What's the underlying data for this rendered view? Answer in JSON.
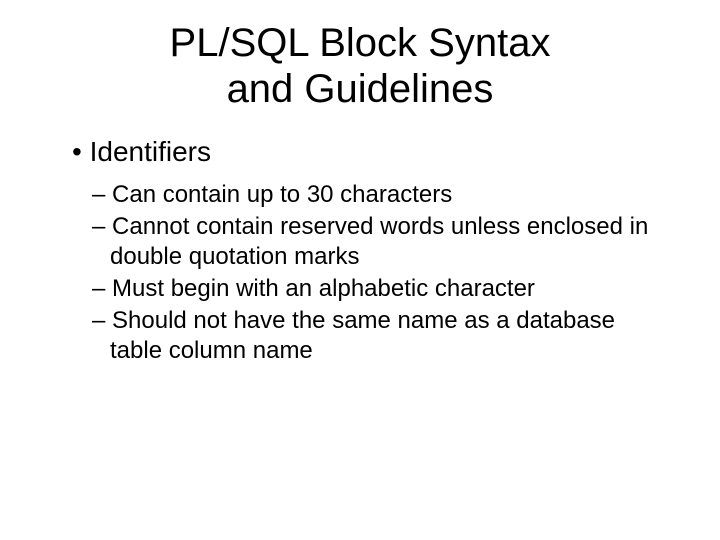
{
  "title_line1": "PL/SQL Block Syntax",
  "title_line2": "and Guidelines",
  "main_bullet": "Identifiers",
  "sub_bullets": {
    "0": "Can contain up to 30 characters",
    "1": "Cannot contain reserved words unless enclosed in double quotation marks",
    "2": "Must begin with an alphabetic character",
    "3": "Should not have the same name as a database table column name"
  }
}
